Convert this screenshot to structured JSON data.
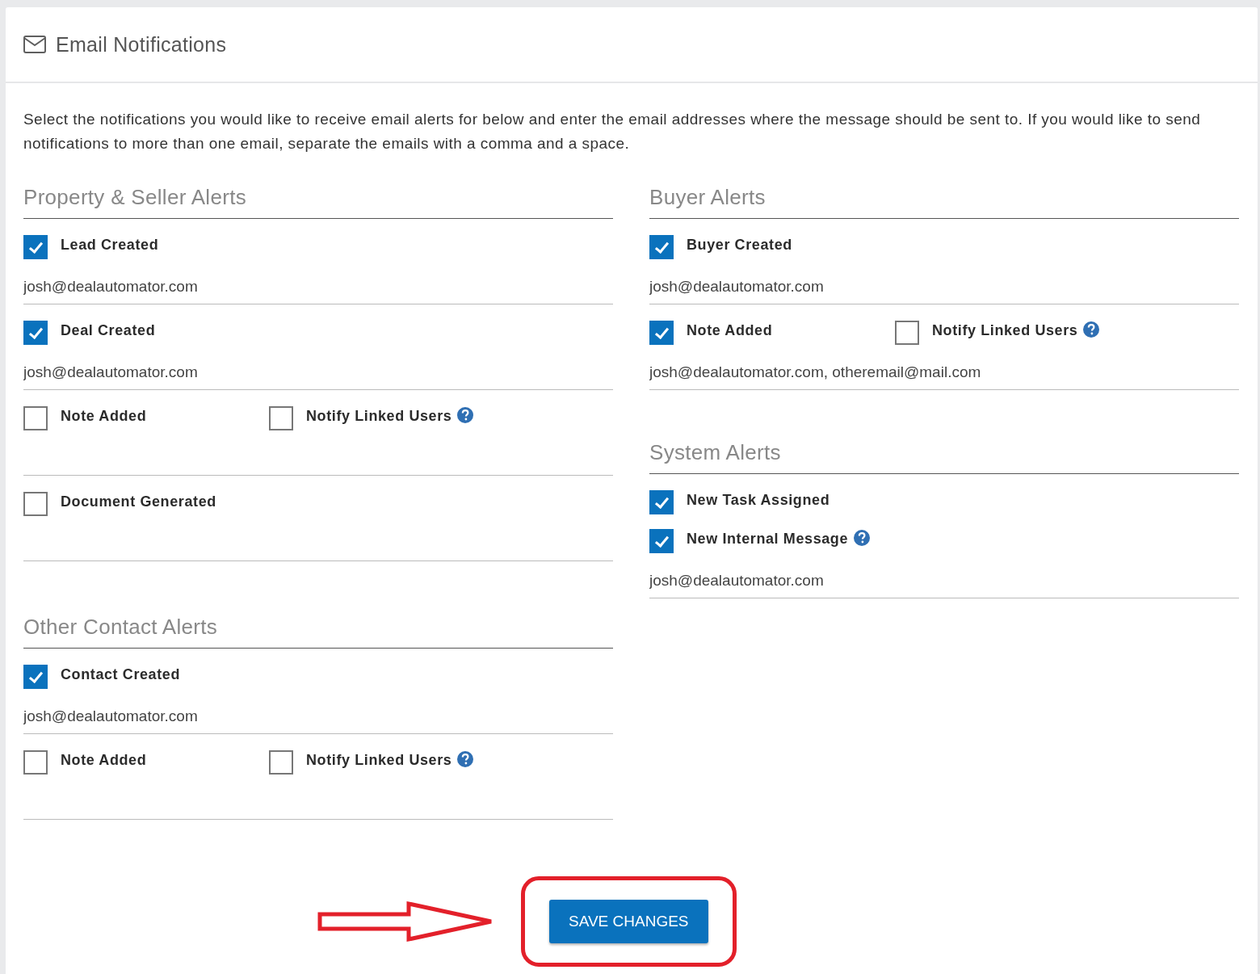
{
  "panel": {
    "title": "Email Notifications",
    "description": "Select the notifications you would like to receive email alerts for below and enter the email addresses where the message should be sent to. If you would like to send notifications to more than one email, separate the emails with a comma and a space."
  },
  "columns": [
    {
      "sections": [
        {
          "title": "Property & Seller Alerts",
          "groups": [
            {
              "rows": [
                [
                  {
                    "label": "Lead Created",
                    "checked": true,
                    "help": false
                  }
                ]
              ],
              "email": "josh@dealautomator.com"
            },
            {
              "rows": [
                [
                  {
                    "label": "Deal Created",
                    "checked": true,
                    "help": false
                  }
                ]
              ],
              "email": "josh@dealautomator.com"
            },
            {
              "rows": [
                [
                  {
                    "label": "Note Added",
                    "checked": false,
                    "help": false
                  },
                  {
                    "label": "Notify Linked Users",
                    "checked": false,
                    "help": true
                  }
                ]
              ]
            },
            {
              "rows": [
                [
                  {
                    "label": "Document Generated",
                    "checked": false,
                    "help": false
                  }
                ]
              ]
            }
          ]
        },
        {
          "title": "Other Contact Alerts",
          "groups": [
            {
              "rows": [
                [
                  {
                    "label": "Contact Created",
                    "checked": true,
                    "help": false
                  }
                ]
              ],
              "email": "josh@dealautomator.com"
            },
            {
              "rows": [
                [
                  {
                    "label": "Note Added",
                    "checked": false,
                    "help": false
                  },
                  {
                    "label": "Notify Linked Users",
                    "checked": false,
                    "help": true
                  }
                ]
              ]
            }
          ]
        }
      ]
    },
    {
      "sections": [
        {
          "title": "Buyer Alerts",
          "groups": [
            {
              "rows": [
                [
                  {
                    "label": "Buyer Created",
                    "checked": true,
                    "help": false
                  }
                ]
              ],
              "email": "josh@dealautomator.com"
            },
            {
              "rows": [
                [
                  {
                    "label": "Note Added",
                    "checked": true,
                    "help": false
                  },
                  {
                    "label": "Notify Linked Users",
                    "checked": false,
                    "help": true
                  }
                ]
              ],
              "email": "josh@dealautomator.com, otheremail@mail.com"
            }
          ]
        },
        {
          "title": "System Alerts",
          "groups": [
            {
              "rows": [
                [
                  {
                    "label": "New Task Assigned",
                    "checked": true,
                    "help": false
                  }
                ],
                [
                  {
                    "label": "New Internal Message",
                    "checked": true,
                    "help": true
                  }
                ]
              ],
              "email": "josh@dealautomator.com"
            }
          ]
        }
      ]
    }
  ],
  "save_button": {
    "label": "SAVE CHANGES"
  }
}
